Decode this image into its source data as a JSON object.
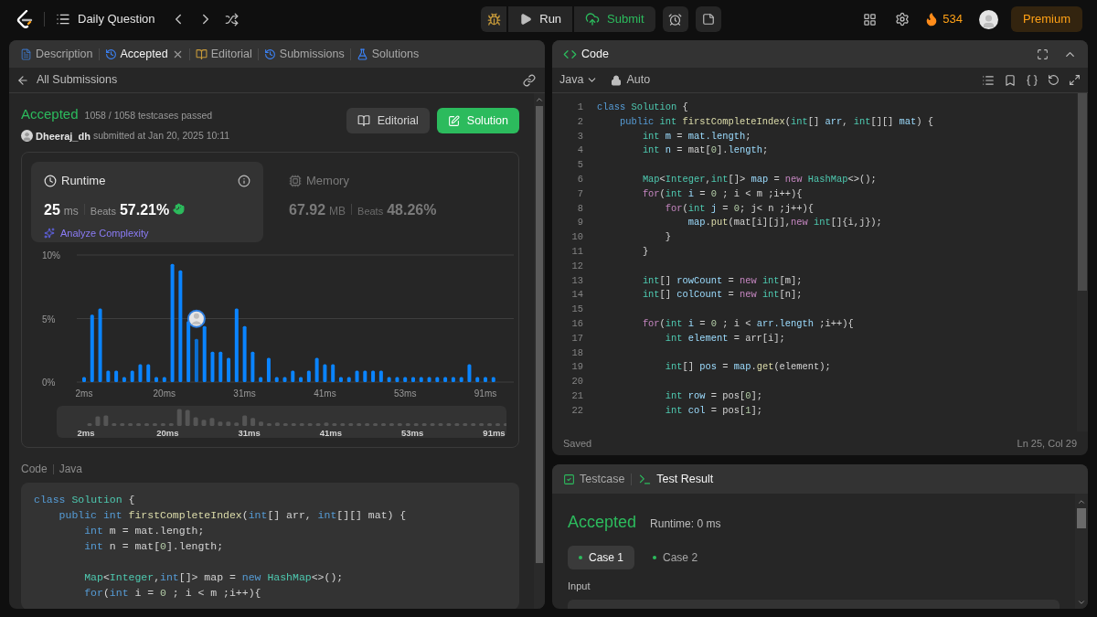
{
  "nav": {
    "title": "Daily Question",
    "actions": [
      {
        "kind": "run",
        "label": "Run"
      },
      {
        "kind": "submit",
        "label": "Submit"
      }
    ],
    "streak": "534",
    "premium": "Premium"
  },
  "left_panel": {
    "tabs": [
      {
        "label": "Description",
        "kind": "description",
        "selected": false,
        "closable": false
      },
      {
        "label": "Accepted",
        "kind": "history",
        "selected": true,
        "closable": true
      },
      {
        "label": "Editorial",
        "kind": "book",
        "selected": false,
        "closable": false
      },
      {
        "label": "Submissions",
        "kind": "history",
        "selected": false,
        "closable": false
      },
      {
        "label": "Solutions",
        "kind": "flask",
        "selected": false,
        "closable": false
      }
    ],
    "back_link": "All Submissions",
    "result": {
      "status": "Accepted",
      "testcases": "1058 / 1058 testcases passed",
      "user": "Dheeraj_dh",
      "submitted": "submitted at Jan 20, 2025 10:11"
    },
    "buttons": [
      {
        "kind": "editorial",
        "label": "Editorial"
      },
      {
        "kind": "solution",
        "label": "Solution"
      }
    ],
    "stats": [
      {
        "kind": "runtime",
        "title": "Runtime",
        "value": "25",
        "unit": "ms",
        "beats_label": "Beats",
        "beats": "57.21%",
        "link": "Analyze Complexity",
        "selected": true
      },
      {
        "kind": "memory",
        "title": "Memory",
        "value": "67.92",
        "unit": "MB",
        "beats_label": "Beats",
        "beats": "48.26%",
        "selected": false
      }
    ],
    "chart_data": {
      "type": "bar",
      "ylim": [
        0,
        10
      ],
      "yticks": [
        {
          "value": 0,
          "label": "0%"
        },
        {
          "value": 5,
          "label": "5%"
        },
        {
          "value": 10,
          "label": "10%"
        }
      ],
      "categories": [
        "2ms",
        null,
        null,
        null,
        null,
        null,
        null,
        null,
        null,
        null,
        "20ms",
        null,
        null,
        null,
        null,
        null,
        null,
        null,
        null,
        null,
        "31ms",
        null,
        null,
        null,
        null,
        null,
        null,
        null,
        null,
        null,
        "41ms",
        null,
        null,
        null,
        null,
        null,
        null,
        null,
        null,
        null,
        "53ms",
        null,
        null,
        null,
        null,
        null,
        null,
        null,
        null,
        null,
        "91ms",
        null
      ],
      "values": [
        0.4,
        5.3,
        5.8,
        0.9,
        0.9,
        0.4,
        0.9,
        1.4,
        1.4,
        0.4,
        0.4,
        9.3,
        8.8,
        4.8,
        3.4,
        4.4,
        2.4,
        2.4,
        1.9,
        5.8,
        4.4,
        2.4,
        0.4,
        1.9,
        0.4,
        0.4,
        0.9,
        0.4,
        0.9,
        1.9,
        1.4,
        1.4,
        0.4,
        0.4,
        0.9,
        0.9,
        0.9,
        0.9,
        0.4,
        0.4,
        0.4,
        0.4,
        0.4,
        0.4,
        0.4,
        0.4,
        0.4,
        0.4,
        1.4,
        0.4,
        0.4,
        0.4
      ]
    },
    "overview": {
      "labels": [
        "2ms",
        "20ms",
        "31ms",
        "41ms",
        "53ms",
        "91ms"
      ]
    },
    "code_section": {
      "label": "Code",
      "language": "Java",
      "lines": [
        {
          "kind": "code",
          "tokens": [
            {
              "kind": "k",
              "text": "class "
            },
            {
              "kind": "t",
              "text": "Solution"
            },
            {
              "kind": "p",
              "text": " {"
            }
          ]
        },
        {
          "kind": "code",
          "tokens": [
            {
              "kind": "k",
              "text": "    public int "
            },
            {
              "kind": "f",
              "text": "firstCompleteIndex"
            },
            {
              "kind": "p",
              "text": "("
            },
            {
              "kind": "k",
              "text": "int"
            },
            {
              "kind": "p",
              "text": "[] arr, "
            },
            {
              "kind": "k",
              "text": "int"
            },
            {
              "kind": "p",
              "text": "[][] mat) {"
            }
          ]
        },
        {
          "kind": "code",
          "tokens": [
            {
              "kind": "k",
              "text": "        int "
            },
            {
              "kind": "p",
              "text": "m = mat.length;"
            }
          ]
        },
        {
          "kind": "code",
          "tokens": [
            {
              "kind": "k",
              "text": "        int "
            },
            {
              "kind": "p",
              "text": "n = mat["
            },
            {
              "kind": "n",
              "text": "0"
            },
            {
              "kind": "p",
              "text": "].length;"
            }
          ]
        },
        {
          "kind": "blank"
        },
        {
          "kind": "code",
          "tokens": [
            {
              "kind": "t",
              "text": "        Map"
            },
            {
              "kind": "p",
              "text": "<"
            },
            {
              "kind": "t",
              "text": "Integer"
            },
            {
              "kind": "p",
              "text": ","
            },
            {
              "kind": "k",
              "text": "int"
            },
            {
              "kind": "p",
              "text": "[]> map = "
            },
            {
              "kind": "k",
              "text": "new "
            },
            {
              "kind": "t",
              "text": "HashMap"
            },
            {
              "kind": "p",
              "text": "<>();"
            }
          ]
        },
        {
          "kind": "code",
          "tokens": [
            {
              "kind": "k",
              "text": "        for"
            },
            {
              "kind": "p",
              "text": "("
            },
            {
              "kind": "k",
              "text": "int "
            },
            {
              "kind": "p",
              "text": "i = "
            },
            {
              "kind": "n",
              "text": "0"
            },
            {
              "kind": "p",
              "text": " ; i < m ;i++){"
            }
          ]
        }
      ]
    }
  },
  "editor": {
    "title": "Code",
    "language": "Java",
    "mode": "Auto",
    "status": "Saved",
    "cursor": "Ln 25, Col 29",
    "lines": [
      {
        "no": "1",
        "tokens": [
          {
            "kind": "k",
            "text": "class "
          },
          {
            "kind": "t",
            "text": "Solution"
          },
          {
            "kind": "p",
            "text": " {"
          }
        ]
      },
      {
        "no": "2",
        "tokens": [
          {
            "kind": "k",
            "text": "    public "
          },
          {
            "kind": "t",
            "text": "int "
          },
          {
            "kind": "f",
            "text": "firstCompleteIndex"
          },
          {
            "kind": "p",
            "text": "("
          },
          {
            "kind": "t",
            "text": "int"
          },
          {
            "kind": "p",
            "text": "[] "
          },
          {
            "kind": "v",
            "text": "arr"
          },
          {
            "kind": "p",
            "text": ", "
          },
          {
            "kind": "t",
            "text": "int"
          },
          {
            "kind": "p",
            "text": "[][] "
          },
          {
            "kind": "v",
            "text": "mat"
          },
          {
            "kind": "p",
            "text": ") {"
          }
        ]
      },
      {
        "no": "3",
        "tokens": [
          {
            "kind": "t",
            "text": "        int "
          },
          {
            "kind": "v",
            "text": "m"
          },
          {
            "kind": "p",
            "text": " = "
          },
          {
            "kind": "v",
            "text": "mat.length"
          },
          {
            "kind": "p",
            "text": ";"
          }
        ]
      },
      {
        "no": "4",
        "tokens": [
          {
            "kind": "t",
            "text": "        int "
          },
          {
            "kind": "v",
            "text": "n"
          },
          {
            "kind": "p",
            "text": " = mat["
          },
          {
            "kind": "n",
            "text": "0"
          },
          {
            "kind": "p",
            "text": "]."
          },
          {
            "kind": "v",
            "text": "length"
          },
          {
            "kind": "p",
            "text": ";"
          }
        ]
      },
      {
        "no": "5"
      },
      {
        "no": "6",
        "tokens": [
          {
            "kind": "t",
            "text": "        Map"
          },
          {
            "kind": "p",
            "text": "<"
          },
          {
            "kind": "t",
            "text": "Integer"
          },
          {
            "kind": "p",
            "text": ","
          },
          {
            "kind": "t",
            "text": "int"
          },
          {
            "kind": "p",
            "text": "[]> "
          },
          {
            "kind": "v",
            "text": "map"
          },
          {
            "kind": "p",
            "text": " = "
          },
          {
            "kind": "c",
            "text": "new "
          },
          {
            "kind": "t",
            "text": "HashMap"
          },
          {
            "kind": "p",
            "text": "<>();"
          }
        ]
      },
      {
        "no": "7",
        "tokens": [
          {
            "kind": "c",
            "text": "        for"
          },
          {
            "kind": "p",
            "text": "("
          },
          {
            "kind": "t",
            "text": "int "
          },
          {
            "kind": "v",
            "text": "i"
          },
          {
            "kind": "p",
            "text": " = "
          },
          {
            "kind": "n",
            "text": "0"
          },
          {
            "kind": "p",
            "text": " ; i < m ;i++){"
          }
        ]
      },
      {
        "no": "8",
        "tokens": [
          {
            "kind": "c",
            "text": "            for"
          },
          {
            "kind": "p",
            "text": "("
          },
          {
            "kind": "t",
            "text": "int "
          },
          {
            "kind": "v",
            "text": "j"
          },
          {
            "kind": "p",
            "text": " = "
          },
          {
            "kind": "n",
            "text": "0"
          },
          {
            "kind": "p",
            "text": "; j< n ;j++){"
          }
        ]
      },
      {
        "no": "9",
        "tokens": [
          {
            "kind": "v",
            "text": "                map"
          },
          {
            "kind": "p",
            "text": "."
          },
          {
            "kind": "f",
            "text": "put"
          },
          {
            "kind": "p",
            "text": "(mat[i][j],"
          },
          {
            "kind": "c",
            "text": "new "
          },
          {
            "kind": "t",
            "text": "int"
          },
          {
            "kind": "p",
            "text": "[]{i,j});"
          }
        ]
      },
      {
        "no": "10",
        "tokens": [
          {
            "kind": "p",
            "text": "            }"
          }
        ]
      },
      {
        "no": "11",
        "tokens": [
          {
            "kind": "p",
            "text": "        }"
          }
        ]
      },
      {
        "no": "12"
      },
      {
        "no": "13",
        "tokens": [
          {
            "kind": "t",
            "text": "        int"
          },
          {
            "kind": "p",
            "text": "[] "
          },
          {
            "kind": "v",
            "text": "rowCount"
          },
          {
            "kind": "p",
            "text": " = "
          },
          {
            "kind": "c",
            "text": "new "
          },
          {
            "kind": "t",
            "text": "int"
          },
          {
            "kind": "p",
            "text": "[m];"
          }
        ]
      },
      {
        "no": "14",
        "tokens": [
          {
            "kind": "t",
            "text": "        int"
          },
          {
            "kind": "p",
            "text": "[] "
          },
          {
            "kind": "v",
            "text": "colCount"
          },
          {
            "kind": "p",
            "text": " = "
          },
          {
            "kind": "c",
            "text": "new "
          },
          {
            "kind": "t",
            "text": "int"
          },
          {
            "kind": "p",
            "text": "[n];"
          }
        ]
      },
      {
        "no": "15"
      },
      {
        "no": "16",
        "tokens": [
          {
            "kind": "c",
            "text": "        for"
          },
          {
            "kind": "p",
            "text": "("
          },
          {
            "kind": "t",
            "text": "int "
          },
          {
            "kind": "v",
            "text": "i"
          },
          {
            "kind": "p",
            "text": " = "
          },
          {
            "kind": "n",
            "text": "0"
          },
          {
            "kind": "p",
            "text": " ; i < "
          },
          {
            "kind": "v",
            "text": "arr.length"
          },
          {
            "kind": "p",
            "text": " ;i++){"
          }
        ]
      },
      {
        "no": "17",
        "tokens": [
          {
            "kind": "t",
            "text": "            int "
          },
          {
            "kind": "v",
            "text": "element"
          },
          {
            "kind": "p",
            "text": " = arr[i];"
          }
        ]
      },
      {
        "no": "18"
      },
      {
        "no": "19",
        "tokens": [
          {
            "kind": "t",
            "text": "            int"
          },
          {
            "kind": "p",
            "text": "[] "
          },
          {
            "kind": "v",
            "text": "pos"
          },
          {
            "kind": "p",
            "text": " = "
          },
          {
            "kind": "v",
            "text": "map"
          },
          {
            "kind": "p",
            "text": "."
          },
          {
            "kind": "f",
            "text": "get"
          },
          {
            "kind": "p",
            "text": "(element);"
          }
        ]
      },
      {
        "no": "20"
      },
      {
        "no": "21",
        "tokens": [
          {
            "kind": "t",
            "text": "            int "
          },
          {
            "kind": "v",
            "text": "row"
          },
          {
            "kind": "p",
            "text": " = pos["
          },
          {
            "kind": "n",
            "text": "0"
          },
          {
            "kind": "p",
            "text": "];"
          }
        ]
      },
      {
        "no": "22",
        "tokens": [
          {
            "kind": "t",
            "text": "            int "
          },
          {
            "kind": "v",
            "text": "col"
          },
          {
            "kind": "p",
            "text": " = pos["
          },
          {
            "kind": "n",
            "text": "1"
          },
          {
            "kind": "p",
            "text": "];"
          }
        ]
      }
    ]
  },
  "test_panel": {
    "tabs": [
      {
        "label": "Testcase",
        "kind": "testcase",
        "selected": false
      },
      {
        "label": "Test Result",
        "kind": "result",
        "selected": true
      }
    ],
    "status": "Accepted",
    "runtime": "Runtime: 0 ms",
    "cases": [
      {
        "label": "Case 1",
        "selected": true
      },
      {
        "label": "Case 2",
        "selected": false
      }
    ],
    "input_label": "Input"
  }
}
